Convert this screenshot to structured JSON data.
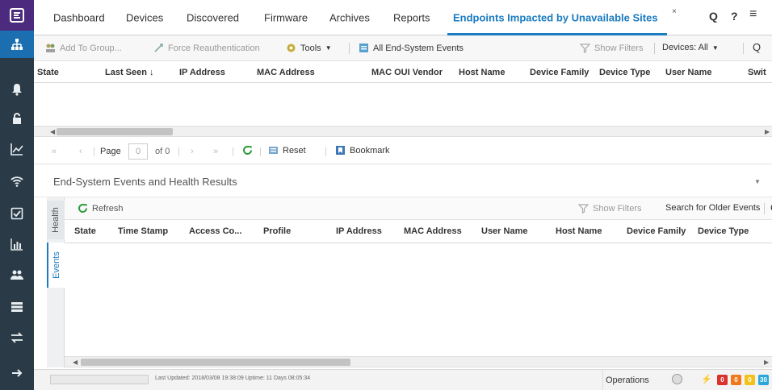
{
  "tabs": {
    "dashboard": "Dashboard",
    "devices": "Devices",
    "discovered": "Discovered",
    "firmware": "Firmware",
    "archives": "Archives",
    "reports": "Reports",
    "endpoints": "Endpoints Impacted by Unavailable Sites",
    "close": "×"
  },
  "header": {
    "search": "Q",
    "help": "?",
    "menu": "≡"
  },
  "toolbar": {
    "add_to_group": "Add To Group...",
    "force_reauth": "Force Reauthentication",
    "tools": "Tools",
    "all_events": "All End-System Events",
    "show_filters": "Show Filters",
    "devices": "Devices: All"
  },
  "grid": {
    "columns": [
      "State",
      "Last Seen ↓",
      "IP Address",
      "MAC Address",
      "MAC OUI Vendor",
      "Host Name",
      "Device Family",
      "Device Type",
      "User Name",
      "Swit"
    ]
  },
  "pager": {
    "page_label": "Page",
    "page_value": "0",
    "of_label": "of 0",
    "reset": "Reset",
    "bookmark": "Bookmark"
  },
  "section": {
    "title": "End-System Events and Health Results"
  },
  "vtabs": {
    "health": "Health",
    "events": "Events"
  },
  "events": {
    "refresh": "Refresh",
    "show_filters": "Show Filters",
    "search_older": "Search for Older Events",
    "columns": [
      "State",
      "Time Stamp",
      "Access Co...",
      "Profile",
      "IP Address",
      "MAC Address",
      "User Name",
      "Host Name",
      "Device Family",
      "Device Type"
    ]
  },
  "status": {
    "last_updated": "Last Updated: 2018/03/08 19:38:09   Uptime: 11 Days 08:05:34",
    "operations": "Operations",
    "badges": [
      "0",
      "0",
      "0",
      "30"
    ]
  },
  "colors": {
    "accent": "#1a7bc0",
    "sidebar": "#2a3a46",
    "logo_bg": "#4c2a7e",
    "badge_red": "#d9312b",
    "badge_orange": "#f07a1a",
    "badge_yellow": "#f2c21b",
    "badge_blue": "#2aa7d8"
  },
  "icons": [
    "logo-icon",
    "network-icon",
    "bell-icon",
    "lock-icon",
    "chart-icon",
    "wifi-icon",
    "checklist-icon",
    "bar-chart-icon",
    "users-icon",
    "server-icon",
    "exchange-icon",
    "arrow-right-icon"
  ]
}
